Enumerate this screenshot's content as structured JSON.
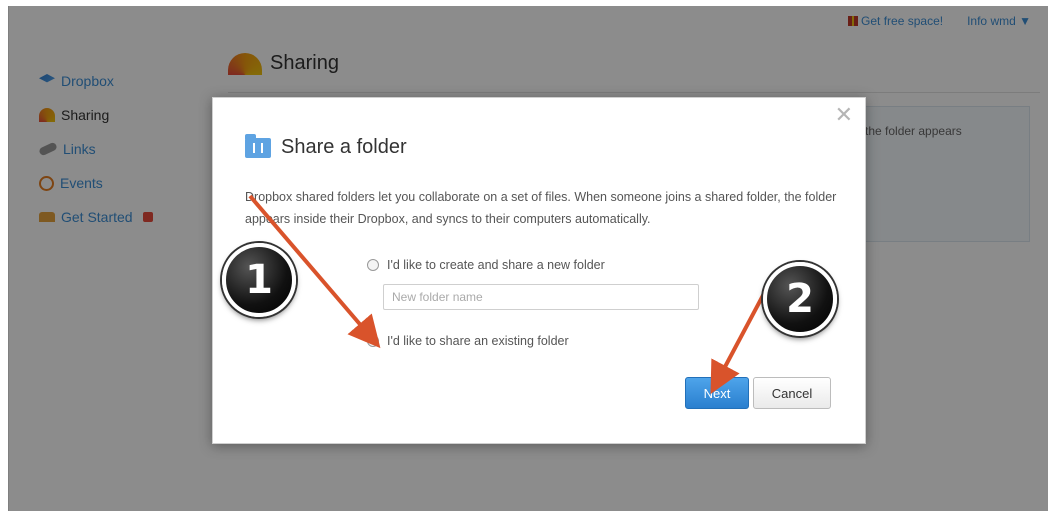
{
  "topbar": {
    "free_space": "Get free space!",
    "user_menu": "Info wmd ▼"
  },
  "sidebar": {
    "items": [
      {
        "label": "Dropbox",
        "icon": "dropbox-icon"
      },
      {
        "label": "Sharing",
        "icon": "rainbow-icon"
      },
      {
        "label": "Links",
        "icon": "link-icon"
      },
      {
        "label": "Events",
        "icon": "clock-icon"
      },
      {
        "label": "Get Started",
        "icon": "gift-icon"
      }
    ]
  },
  "main": {
    "title": "Sharing",
    "behind_text": "the folder appears"
  },
  "modal": {
    "title": "Share a folder",
    "description": "Dropbox shared folders let you collaborate on a set of files. When someone joins a shared folder, the folder appears inside their Dropbox, and syncs to their computers automatically.",
    "option_new": "I'd like to create and share a new folder",
    "new_folder_placeholder": "New folder name",
    "option_existing": "I'd like to share an existing folder",
    "next_label": "Next",
    "cancel_label": "Cancel",
    "close_glyph": "✕"
  },
  "annotations": {
    "step1": "1",
    "step2": "2",
    "arrow_color": "#d9532b"
  }
}
